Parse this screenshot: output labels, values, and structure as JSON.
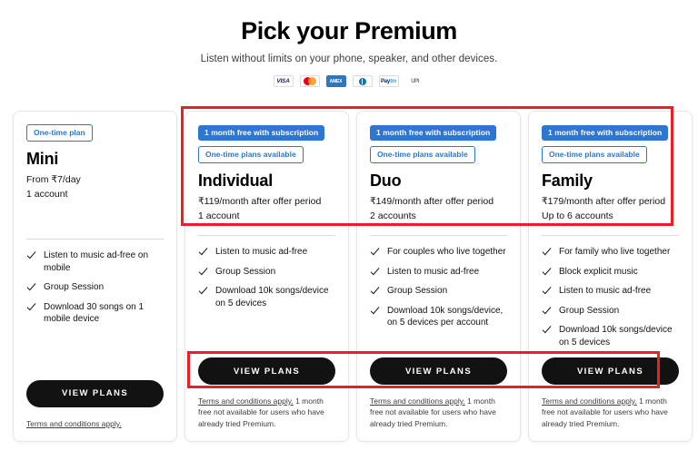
{
  "header": {
    "title": "Pick your Premium",
    "subtitle": "Listen without limits on your phone, speaker, and other devices.",
    "payment_methods": [
      {
        "name": "visa-logo",
        "label": "VISA"
      },
      {
        "name": "mastercard-logo",
        "label": ""
      },
      {
        "name": "amex-logo",
        "label": "AMEX"
      },
      {
        "name": "diners-club-logo",
        "label": "DINERS"
      },
      {
        "name": "paytm-logo",
        "label": "Paytm"
      },
      {
        "name": "upi-logo",
        "label": "UPI"
      }
    ]
  },
  "plans": [
    {
      "id": "mini",
      "top_badge": null,
      "onetime_badge": "One-time plan",
      "name": "Mini",
      "price": "From ₹7/day",
      "accounts": "1 account",
      "features": [
        "Listen to music ad-free on mobile",
        "Group Session",
        "Download 30 songs on 1 mobile device"
      ],
      "cta": "VIEW PLANS",
      "terms_link": "Terms and conditions apply.",
      "terms_rest": ""
    },
    {
      "id": "individual",
      "top_badge": "1 month free with subscription",
      "onetime_badge": "One-time plans available",
      "name": "Individual",
      "price": "₹119/month after offer period",
      "accounts": "1 account",
      "features": [
        "Listen to music ad-free",
        "Group Session",
        "Download 10k songs/device on 5 devices"
      ],
      "cta": "VIEW PLANS",
      "terms_link": "Terms and conditions apply.",
      "terms_rest": " 1 month free not available for users who have already tried Premium."
    },
    {
      "id": "duo",
      "top_badge": "1 month free with subscription",
      "onetime_badge": "One-time plans available",
      "name": "Duo",
      "price": "₹149/month after offer period",
      "accounts": "2 accounts",
      "features": [
        "For couples who live together",
        "Listen to music ad-free",
        "Group Session",
        "Download 10k songs/device, on 5 devices per account"
      ],
      "cta": "VIEW PLANS",
      "terms_link": "Terms and conditions apply.",
      "terms_rest": " 1 month free not available for users who have already tried Premium."
    },
    {
      "id": "family",
      "top_badge": "1 month free with subscription",
      "onetime_badge": "One-time plans available",
      "name": "Family",
      "price": "₹179/month after offer period",
      "accounts": "Up to 6 accounts",
      "features": [
        "For family who live together",
        "Block explicit music",
        "Listen to music ad-free",
        "Group Session",
        "Download 10k songs/device on 5 devices"
      ],
      "cta": "VIEW PLANS",
      "terms_link": "Terms and conditions apply.",
      "terms_rest": " 1 month free not available for users who have already tried Premium."
    }
  ],
  "annotations": {
    "highlight_color": "#ee1c25",
    "boxes": [
      {
        "name": "plan-headers-highlight"
      },
      {
        "name": "view-plans-buttons-highlight"
      }
    ]
  },
  "colors": {
    "accent_blue": "#2e77d0",
    "button_black": "#121212",
    "card_border": "#e6e6e6"
  }
}
